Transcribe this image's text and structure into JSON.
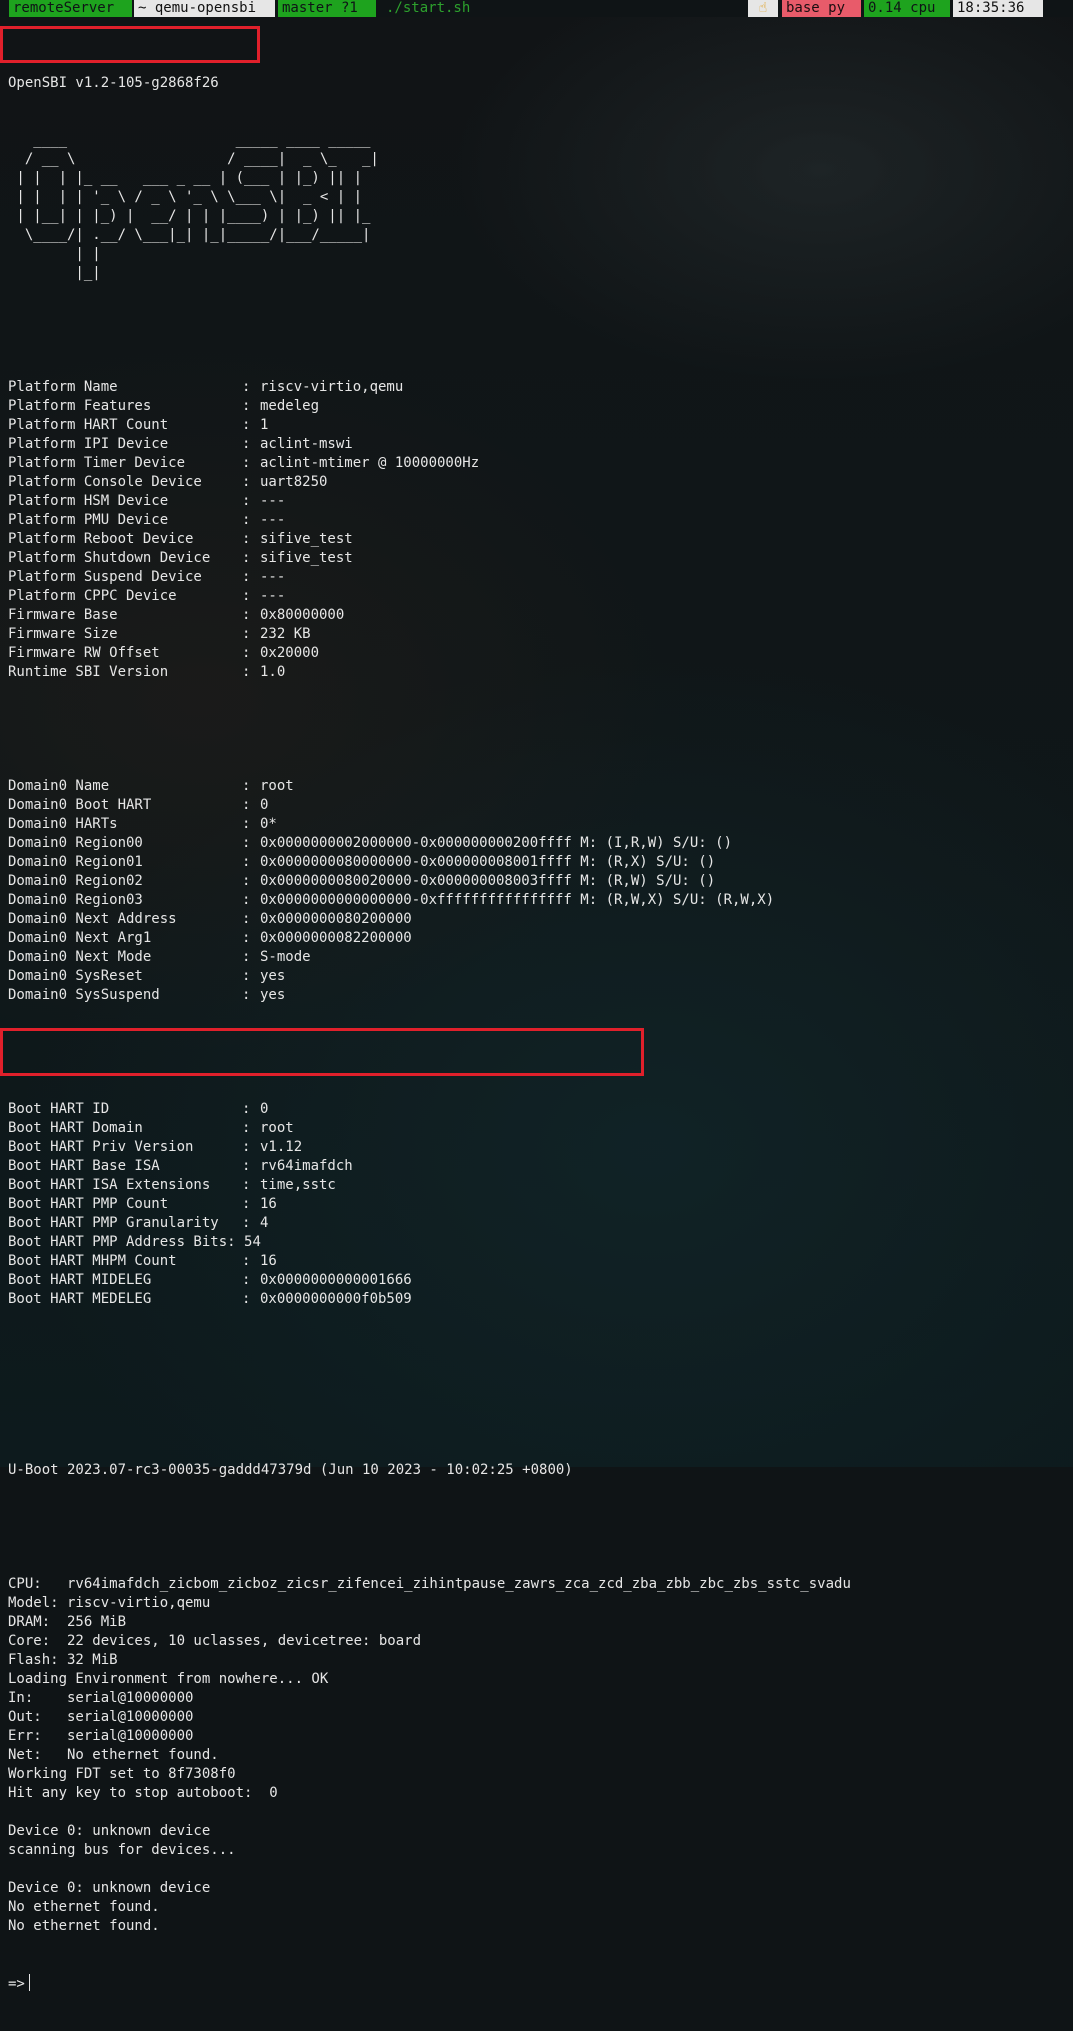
{
  "status": {
    "host": "remoteServer",
    "dir": "~ qemu-opensbi",
    "branch": "master ?1",
    "cmd": "./start.sh",
    "hand_icon": "☝",
    "env": "base py",
    "cpu": "0.14 cpu",
    "time": "18:35:36"
  },
  "opensbi_header": "OpenSBI v1.2-105-g2868f26",
  "logo": [
    "   ____                    _____ ____ _____",
    "  / __ \\                  / ____|  _ \\_   _|",
    " | |  | |_ __   ___ _ __ | (___ | |_) || |",
    " | |  | | '_ \\ / _ \\ '_ \\ \\___ \\|  _ < | |",
    " | |__| | |_) |  __/ | | |____) | |_) || |_",
    "  \\____/| .__/ \\___|_| |_|_____/|___/_____|",
    "        | |",
    "        |_|"
  ],
  "platform": [
    {
      "k": "Platform Name",
      "v": "riscv-virtio,qemu"
    },
    {
      "k": "Platform Features",
      "v": "medeleg"
    },
    {
      "k": "Platform HART Count",
      "v": "1"
    },
    {
      "k": "Platform IPI Device",
      "v": "aclint-mswi"
    },
    {
      "k": "Platform Timer Device",
      "v": "aclint-mtimer @ 10000000Hz"
    },
    {
      "k": "Platform Console Device",
      "v": "uart8250"
    },
    {
      "k": "Platform HSM Device",
      "v": "---"
    },
    {
      "k": "Platform PMU Device",
      "v": "---"
    },
    {
      "k": "Platform Reboot Device",
      "v": "sifive_test"
    },
    {
      "k": "Platform Shutdown Device",
      "v": "sifive_test"
    },
    {
      "k": "Platform Suspend Device",
      "v": "---"
    },
    {
      "k": "Platform CPPC Device",
      "v": "---"
    },
    {
      "k": "Firmware Base",
      "v": "0x80000000"
    },
    {
      "k": "Firmware Size",
      "v": "232 KB"
    },
    {
      "k": "Firmware RW Offset",
      "v": "0x20000"
    },
    {
      "k": "Runtime SBI Version",
      "v": "1.0"
    }
  ],
  "domain": [
    {
      "k": "Domain0 Name",
      "v": "root"
    },
    {
      "k": "Domain0 Boot HART",
      "v": "0"
    },
    {
      "k": "Domain0 HARTs",
      "v": "0*"
    },
    {
      "k": "Domain0 Region00",
      "v": "0x0000000002000000-0x000000000200ffff M: (I,R,W) S/U: ()"
    },
    {
      "k": "Domain0 Region01",
      "v": "0x0000000080000000-0x000000008001ffff M: (R,X) S/U: ()"
    },
    {
      "k": "Domain0 Region02",
      "v": "0x0000000080020000-0x000000008003ffff M: (R,W) S/U: ()"
    },
    {
      "k": "Domain0 Region03",
      "v": "0x0000000000000000-0xffffffffffffffff M: (R,W,X) S/U: (R,W,X)"
    },
    {
      "k": "Domain0 Next Address",
      "v": "0x0000000080200000"
    },
    {
      "k": "Domain0 Next Arg1",
      "v": "0x0000000082200000"
    },
    {
      "k": "Domain0 Next Mode",
      "v": "S-mode"
    },
    {
      "k": "Domain0 SysReset",
      "v": "yes"
    },
    {
      "k": "Domain0 SysSuspend",
      "v": "yes"
    }
  ],
  "boot_hart": [
    {
      "k": "Boot HART ID",
      "v": "0"
    },
    {
      "k": "Boot HART Domain",
      "v": "root"
    },
    {
      "k": "Boot HART Priv Version",
      "v": "v1.12"
    },
    {
      "k": "Boot HART Base ISA",
      "v": "rv64imafdch"
    },
    {
      "k": "Boot HART ISA Extensions",
      "v": "time,sstc"
    },
    {
      "k": "Boot HART PMP Count",
      "v": "16"
    },
    {
      "k": "Boot HART PMP Granularity",
      "v": "4"
    },
    {
      "k": "Boot HART PMP Address Bits",
      "v": "54"
    },
    {
      "k": "Boot HART MHPM Count",
      "v": "16"
    },
    {
      "k": "Boot HART MIDELEG",
      "v": "0x0000000000001666"
    },
    {
      "k": "Boot HART MEDELEG",
      "v": "0x0000000000f0b509"
    }
  ],
  "uboot_header": "U-Boot 2023.07-rc3-00035-gaddd47379d (Jun 10 2023 - 10:02:25 +0800)",
  "uboot_lines": [
    "CPU:   rv64imafdch_zicbom_zicboz_zicsr_zifencei_zihintpause_zawrs_zca_zcd_zba_zbb_zbc_zbs_sstc_svadu",
    "Model: riscv-virtio,qemu",
    "DRAM:  256 MiB",
    "Core:  22 devices, 10 uclasses, devicetree: board",
    "Flash: 32 MiB",
    "Loading Environment from nowhere... OK",
    "In:    serial@10000000",
    "Out:   serial@10000000",
    "Err:   serial@10000000",
    "Net:   No ethernet found.",
    "Working FDT set to 8f7308f0",
    "Hit any key to stop autoboot:  0",
    "",
    "Device 0: unknown device",
    "scanning bus for devices...",
    "",
    "Device 0: unknown device",
    "No ethernet found.",
    "No ethernet found."
  ],
  "prompt": "=>",
  "colors": {
    "highlight": "#e0202b",
    "green": "#1ea31e",
    "red": "#e85b6a"
  }
}
